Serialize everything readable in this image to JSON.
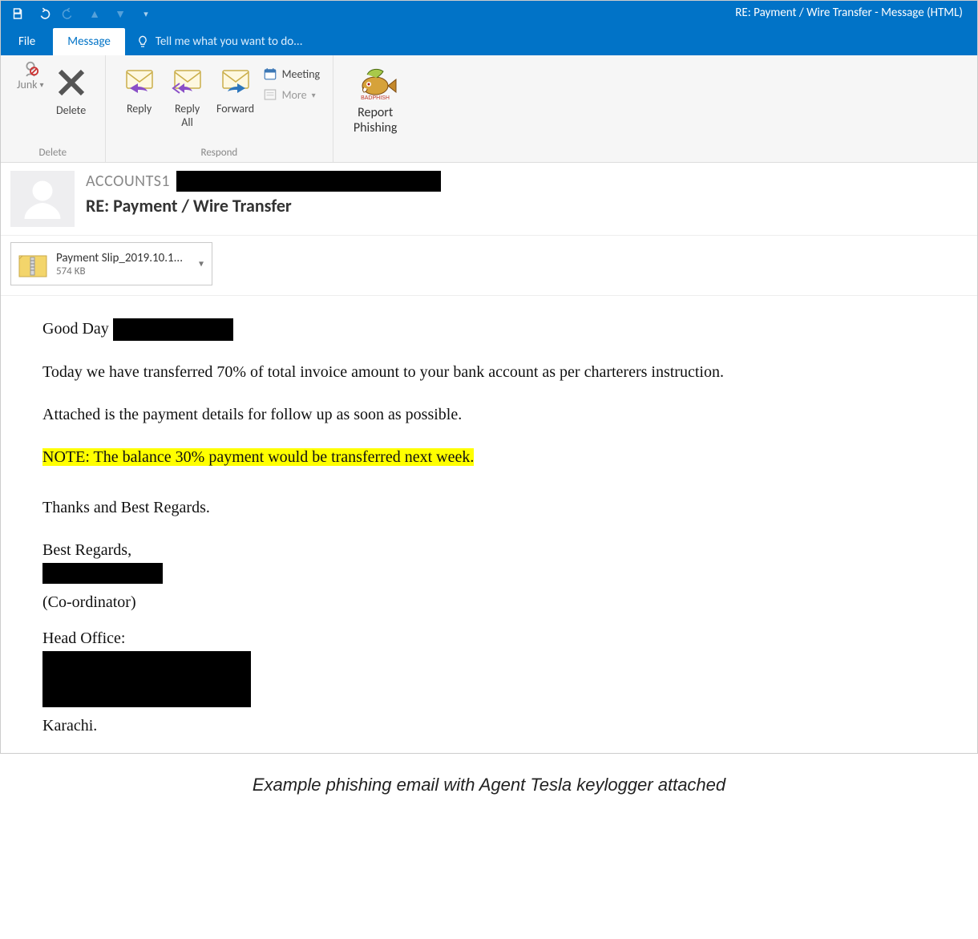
{
  "window": {
    "title": "RE: Payment / Wire Transfer - Message (HTML)"
  },
  "tabs": {
    "file": "File",
    "message": "Message",
    "tellme": "Tell me what you want to do..."
  },
  "ribbon": {
    "junk": "Junk",
    "delete": "Delete",
    "delete_group": "Delete",
    "reply": "Reply",
    "reply_all": "Reply\nAll",
    "forward": "Forward",
    "meeting": "Meeting",
    "more": "More",
    "respond_group": "Respond",
    "report_phishing": "Report\nPhishing"
  },
  "header": {
    "sender": "ACCOUNTS1",
    "subject": "RE: Payment / Wire Transfer"
  },
  "attachment": {
    "name": "Payment Slip_2019.10.1...",
    "size": "574 KB"
  },
  "body": {
    "greeting": "Good Day",
    "p1": "Today we have transferred 70% of  total invoice amount to your bank account as per charterers instruction.",
    "p2": "Attached is the payment details for follow up as soon as possible.",
    "note": "NOTE: The balance 30% payment would be transferred next week.",
    "thanks": "Thanks and Best Regards.",
    "sig1": "Best Regards,",
    "sig2": "(Co-ordinator)",
    "sig3": "Head Office:",
    "sig4": "Karachi."
  },
  "caption": "Example phishing email with Agent Tesla keylogger attached"
}
